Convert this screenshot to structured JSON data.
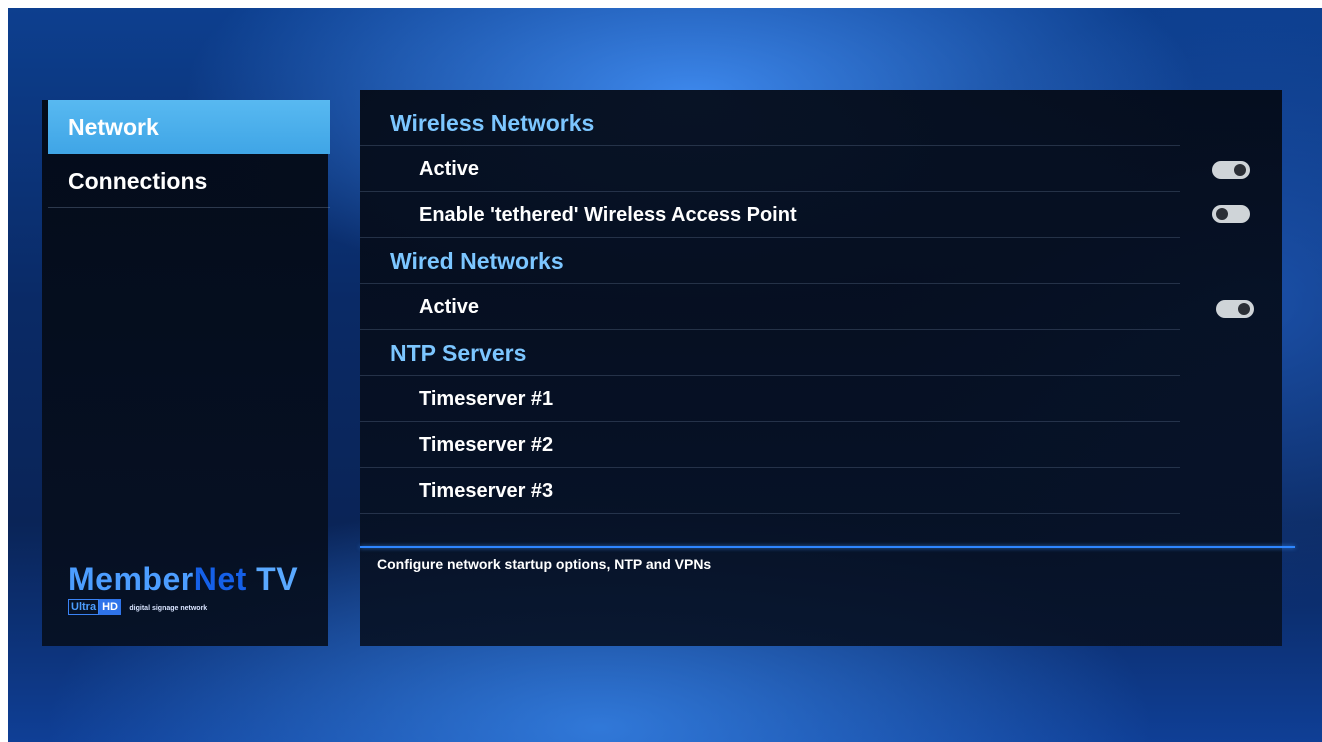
{
  "sidebar": {
    "items": [
      {
        "label": "Network",
        "selected": true
      },
      {
        "label": "Connections",
        "selected": false
      }
    ]
  },
  "logo": {
    "member": "Member",
    "net": "Net",
    "tv": "TV",
    "ultra": "Ultra",
    "hd": "HD",
    "tagline": "digital signage network"
  },
  "sections": {
    "wireless": {
      "title": "Wireless Networks",
      "active_label": "Active",
      "active_on": true,
      "tethered_label": "Enable 'tethered' Wireless Access Point",
      "tethered_on": false
    },
    "wired": {
      "title": "Wired Networks",
      "active_label": "Active",
      "active_on": true
    },
    "ntp": {
      "title": "NTP Servers",
      "servers": [
        "Timeserver #1",
        "Timeserver #2",
        "Timeserver #3"
      ]
    }
  },
  "description": "Configure network startup options, NTP and VPNs",
  "colors": {
    "selected_bg": "#4fb2ef",
    "header_text": "#7cc6ff",
    "divider": "#2e86ff"
  }
}
